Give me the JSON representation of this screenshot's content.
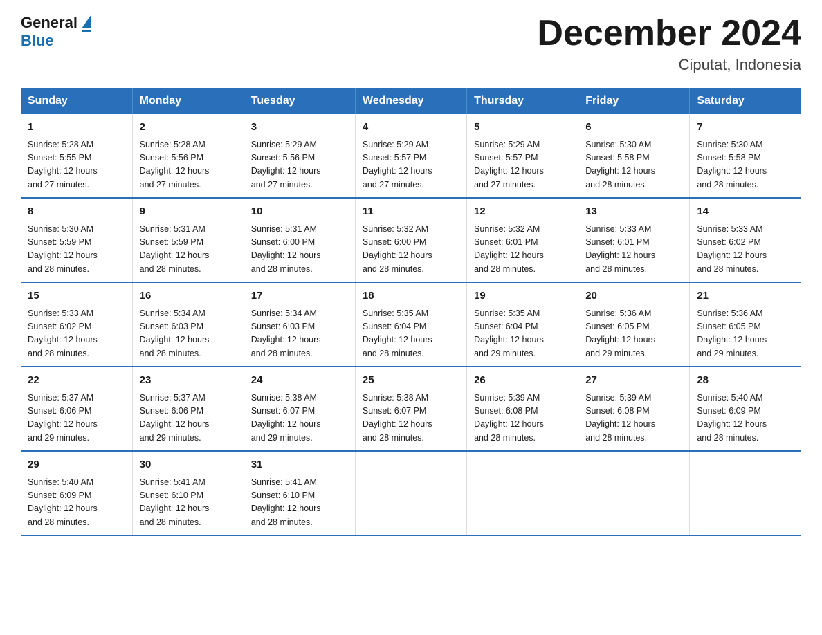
{
  "logo": {
    "text_general": "General",
    "text_blue": "Blue"
  },
  "title": "December 2024",
  "subtitle": "Ciputat, Indonesia",
  "days_of_week": [
    "Sunday",
    "Monday",
    "Tuesday",
    "Wednesday",
    "Thursday",
    "Friday",
    "Saturday"
  ],
  "weeks": [
    [
      {
        "day": "1",
        "sunrise": "5:28 AM",
        "sunset": "5:55 PM",
        "daylight": "12 hours and 27 minutes."
      },
      {
        "day": "2",
        "sunrise": "5:28 AM",
        "sunset": "5:56 PM",
        "daylight": "12 hours and 27 minutes."
      },
      {
        "day": "3",
        "sunrise": "5:29 AM",
        "sunset": "5:56 PM",
        "daylight": "12 hours and 27 minutes."
      },
      {
        "day": "4",
        "sunrise": "5:29 AM",
        "sunset": "5:57 PM",
        "daylight": "12 hours and 27 minutes."
      },
      {
        "day": "5",
        "sunrise": "5:29 AM",
        "sunset": "5:57 PM",
        "daylight": "12 hours and 27 minutes."
      },
      {
        "day": "6",
        "sunrise": "5:30 AM",
        "sunset": "5:58 PM",
        "daylight": "12 hours and 28 minutes."
      },
      {
        "day": "7",
        "sunrise": "5:30 AM",
        "sunset": "5:58 PM",
        "daylight": "12 hours and 28 minutes."
      }
    ],
    [
      {
        "day": "8",
        "sunrise": "5:30 AM",
        "sunset": "5:59 PM",
        "daylight": "12 hours and 28 minutes."
      },
      {
        "day": "9",
        "sunrise": "5:31 AM",
        "sunset": "5:59 PM",
        "daylight": "12 hours and 28 minutes."
      },
      {
        "day": "10",
        "sunrise": "5:31 AM",
        "sunset": "6:00 PM",
        "daylight": "12 hours and 28 minutes."
      },
      {
        "day": "11",
        "sunrise": "5:32 AM",
        "sunset": "6:00 PM",
        "daylight": "12 hours and 28 minutes."
      },
      {
        "day": "12",
        "sunrise": "5:32 AM",
        "sunset": "6:01 PM",
        "daylight": "12 hours and 28 minutes."
      },
      {
        "day": "13",
        "sunrise": "5:33 AM",
        "sunset": "6:01 PM",
        "daylight": "12 hours and 28 minutes."
      },
      {
        "day": "14",
        "sunrise": "5:33 AM",
        "sunset": "6:02 PM",
        "daylight": "12 hours and 28 minutes."
      }
    ],
    [
      {
        "day": "15",
        "sunrise": "5:33 AM",
        "sunset": "6:02 PM",
        "daylight": "12 hours and 28 minutes."
      },
      {
        "day": "16",
        "sunrise": "5:34 AM",
        "sunset": "6:03 PM",
        "daylight": "12 hours and 28 minutes."
      },
      {
        "day": "17",
        "sunrise": "5:34 AM",
        "sunset": "6:03 PM",
        "daylight": "12 hours and 28 minutes."
      },
      {
        "day": "18",
        "sunrise": "5:35 AM",
        "sunset": "6:04 PM",
        "daylight": "12 hours and 28 minutes."
      },
      {
        "day": "19",
        "sunrise": "5:35 AM",
        "sunset": "6:04 PM",
        "daylight": "12 hours and 29 minutes."
      },
      {
        "day": "20",
        "sunrise": "5:36 AM",
        "sunset": "6:05 PM",
        "daylight": "12 hours and 29 minutes."
      },
      {
        "day": "21",
        "sunrise": "5:36 AM",
        "sunset": "6:05 PM",
        "daylight": "12 hours and 29 minutes."
      }
    ],
    [
      {
        "day": "22",
        "sunrise": "5:37 AM",
        "sunset": "6:06 PM",
        "daylight": "12 hours and 29 minutes."
      },
      {
        "day": "23",
        "sunrise": "5:37 AM",
        "sunset": "6:06 PM",
        "daylight": "12 hours and 29 minutes."
      },
      {
        "day": "24",
        "sunrise": "5:38 AM",
        "sunset": "6:07 PM",
        "daylight": "12 hours and 29 minutes."
      },
      {
        "day": "25",
        "sunrise": "5:38 AM",
        "sunset": "6:07 PM",
        "daylight": "12 hours and 28 minutes."
      },
      {
        "day": "26",
        "sunrise": "5:39 AM",
        "sunset": "6:08 PM",
        "daylight": "12 hours and 28 minutes."
      },
      {
        "day": "27",
        "sunrise": "5:39 AM",
        "sunset": "6:08 PM",
        "daylight": "12 hours and 28 minutes."
      },
      {
        "day": "28",
        "sunrise": "5:40 AM",
        "sunset": "6:09 PM",
        "daylight": "12 hours and 28 minutes."
      }
    ],
    [
      {
        "day": "29",
        "sunrise": "5:40 AM",
        "sunset": "6:09 PM",
        "daylight": "12 hours and 28 minutes."
      },
      {
        "day": "30",
        "sunrise": "5:41 AM",
        "sunset": "6:10 PM",
        "daylight": "12 hours and 28 minutes."
      },
      {
        "day": "31",
        "sunrise": "5:41 AM",
        "sunset": "6:10 PM",
        "daylight": "12 hours and 28 minutes."
      },
      null,
      null,
      null,
      null
    ]
  ],
  "labels": {
    "sunrise": "Sunrise:",
    "sunset": "Sunset:",
    "daylight": "Daylight:"
  }
}
